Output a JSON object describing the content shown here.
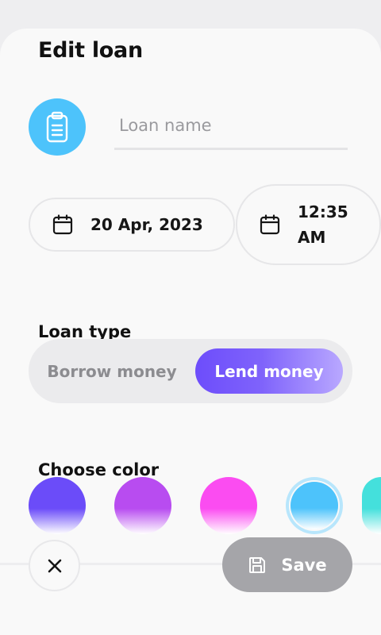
{
  "header": {
    "title": "Edit loan"
  },
  "icon": {
    "name": "clipboard-icon",
    "bg_color": "#4dc3fb"
  },
  "name_field": {
    "placeholder": "Loan name",
    "value": ""
  },
  "date": {
    "value": "20 Apr, 2023",
    "icon": "calendar-icon"
  },
  "time": {
    "value": "12:35\nAM",
    "icon": "calendar-icon"
  },
  "loan_type": {
    "label": "Loan type",
    "options": [
      "Borrow money",
      "Lend money"
    ],
    "selected": "Lend money"
  },
  "colors": {
    "label": "Choose color",
    "swatches": [
      {
        "name": "indigo",
        "color": "#6b4cf9"
      },
      {
        "name": "violet",
        "color": "#b84cf0"
      },
      {
        "name": "magenta",
        "color": "#fb4cf1"
      },
      {
        "name": "sky",
        "color": "#4dc3fb",
        "selected": true
      },
      {
        "name": "teal",
        "color": "#44e0dc"
      }
    ]
  },
  "footer": {
    "close_icon": "close-icon",
    "save_label": "Save",
    "save_icon": "save-icon"
  }
}
